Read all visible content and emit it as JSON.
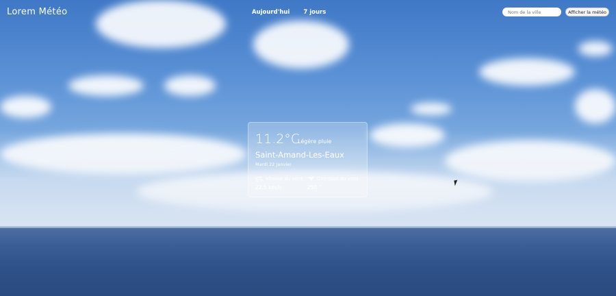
{
  "brand": "Lorem Météo",
  "nav": {
    "today": "Aujourd'hui",
    "week": "7 jours"
  },
  "search": {
    "placeholder": "Nom de la ville",
    "button_label": "Afficher la météo"
  },
  "weather": {
    "temperature": "11.2°C",
    "condition": "Légère pluie",
    "city": "Saint-Amand-Les-Eaux",
    "date": "Mardi 22 Janvier",
    "wind_speed_label": "Vitesse du vent",
    "wind_speed_value": "22.5 km/h",
    "wind_direction_label": "Direction du vent",
    "wind_direction_value": "250 °"
  },
  "icons": {
    "wind_speed": "wind-icon",
    "wind_direction": "direction-arrow-icon"
  }
}
